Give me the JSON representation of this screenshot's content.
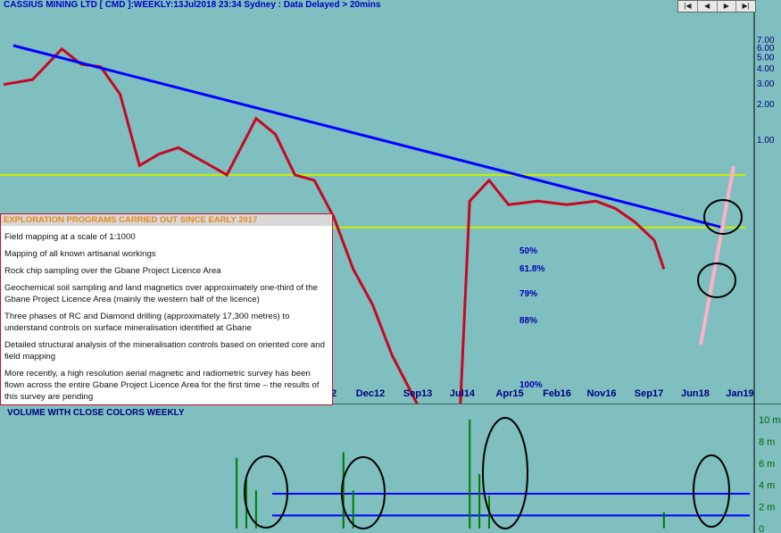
{
  "header": {
    "title": "CASSIUS MINING LTD [ CMD ]:WEEKLY:13Jul2018 23:34 Sydney : Data Delayed > 20mins",
    "nav_buttons": [
      "|◀",
      "◀",
      "▶",
      "▶|"
    ]
  },
  "colors": {
    "background": "#7fbfbf",
    "trendline": "#0000ff",
    "level_line": "#c8f000",
    "up_candle": "#3030ff",
    "down_candle": "#e00000",
    "volume": "#007a00",
    "annotation_circle": "#000000",
    "projection": "#ffb0c8"
  },
  "panel": {
    "heading": "EXPLORATION PROGRAMS CARRIED OUT SINCE EARLY 2017",
    "items": [
      "Field mapping at a scale of 1:1000",
      "Mapping of all known artisanal workings",
      "Rock chip sampling over the Gbane Project Licence Area",
      "Geochemical soil sampling and land magnetics over approximately one-third of the Gbane Project Licence Area (mainly the western half of the licence)",
      "Three phases of RC and Diamond drilling (approximately 17,300 metres) to understand controls on surface mineralisation identified at Gbane",
      "Detailed structural analysis of the mineralisation controls based on oriented core and field mapping",
      "More recently, a high resolution aerial magnetic and radiometric survey has been flown across the entire Gbane Project Licence Area for the first time – the results of this survey are pending"
    ]
  },
  "volume_panel": {
    "title": "VOLUME WITH CLOSE COLORS WEEKLY"
  },
  "chart_data": [
    {
      "type": "candlestick",
      "title": "CASSIUS MINING LTD [ CMD ]:WEEKLY",
      "scale": "log",
      "y_ticks": [
        "7.00",
        "6.00",
        "5.00",
        "4.00",
        "3.00",
        "2.00",
        "1.00"
      ],
      "y_tick_values": [
        7,
        6,
        5,
        4,
        3,
        2,
        1
      ],
      "x_ticks": [
        "2",
        "Dec12",
        "Sep13",
        "Jul14",
        "Apr15",
        "Feb16",
        "Nov16",
        "Sep17",
        "Jun18",
        "Jan19"
      ],
      "fib_labels": [
        "50%",
        "61.8%",
        "79%",
        "88%",
        "100%"
      ],
      "close_path": [
        [
          0,
          2.9
        ],
        [
          3,
          3.2
        ],
        [
          6,
          5.8
        ],
        [
          8,
          4.3
        ],
        [
          10,
          4.1
        ],
        [
          12,
          2.4
        ],
        [
          14,
          0.6
        ],
        [
          16,
          0.75
        ],
        [
          18,
          0.85
        ],
        [
          21,
          0.62
        ],
        [
          23,
          0.5
        ],
        [
          26,
          1.5
        ],
        [
          28,
          1.1
        ],
        [
          30,
          0.5
        ],
        [
          32,
          0.45
        ],
        [
          34,
          0.22
        ],
        [
          36,
          0.08
        ],
        [
          38,
          0.04
        ],
        [
          40,
          0.015
        ],
        [
          43,
          0.005
        ],
        [
          45,
          0.004
        ],
        [
          47,
          0.005
        ],
        [
          48,
          0.3
        ],
        [
          50,
          0.45
        ],
        [
          52,
          0.28
        ],
        [
          55,
          0.3
        ],
        [
          58,
          0.28
        ],
        [
          61,
          0.3
        ],
        [
          63,
          0.26
        ],
        [
          65,
          0.2
        ],
        [
          67,
          0.14
        ],
        [
          68,
          0.08
        ]
      ],
      "trendline": [
        [
          1,
          6.2
        ],
        [
          74,
          0.18
        ]
      ],
      "level_lines": [
        0.5,
        0.18
      ]
    },
    {
      "type": "bar",
      "title": "VOLUME WITH CLOSE COLORS WEEKLY",
      "y_ticks": [
        "10 m",
        "8 m",
        "6 m",
        "4 m",
        "2 m",
        "0"
      ],
      "y_tick_values": [
        10,
        8,
        6,
        4,
        2,
        0
      ],
      "spikes": [
        [
          24,
          6.5
        ],
        [
          25,
          4.5
        ],
        [
          26,
          3.5
        ],
        [
          35,
          7
        ],
        [
          36,
          3.5
        ],
        [
          48,
          10
        ],
        [
          49,
          5
        ],
        [
          50,
          3
        ],
        [
          68,
          1.5
        ]
      ],
      "reference_lines": [
        3.2,
        1.2
      ]
    }
  ]
}
